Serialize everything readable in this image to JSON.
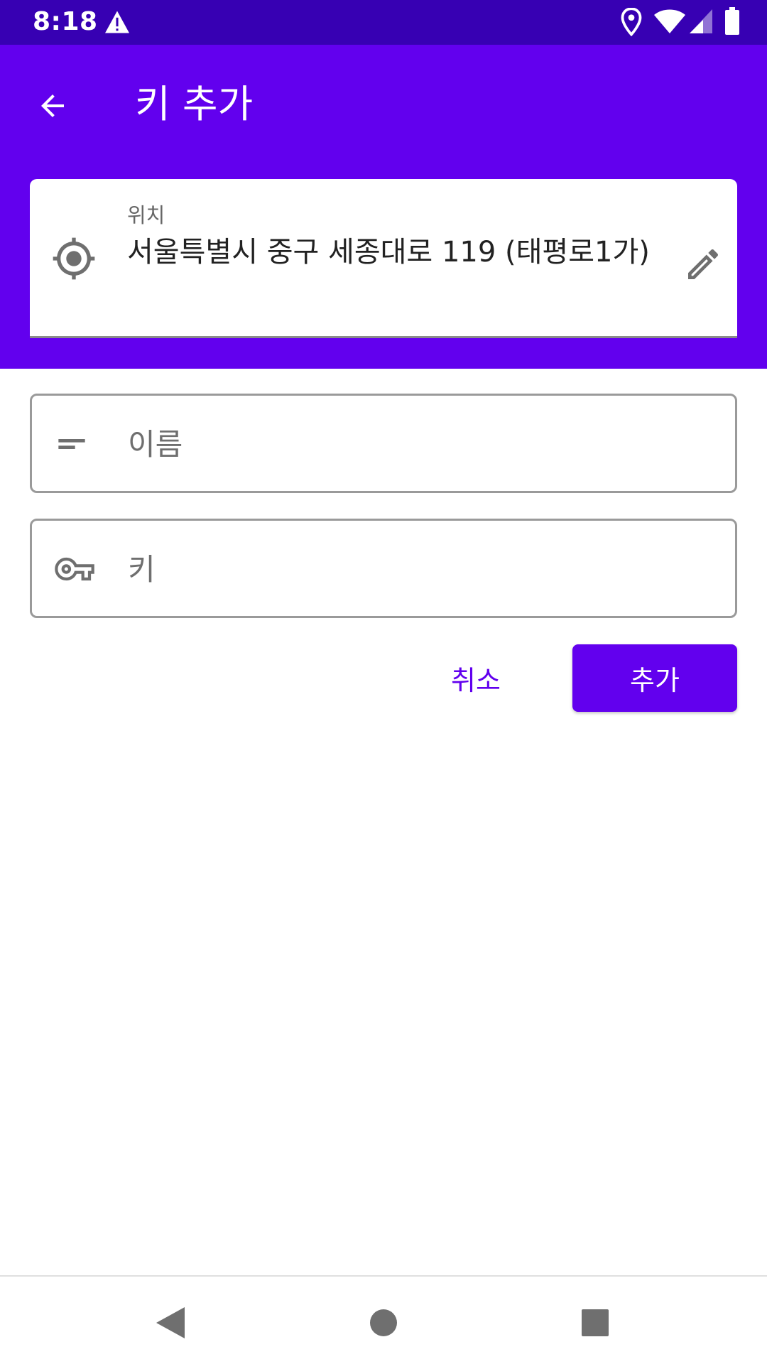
{
  "status_bar": {
    "time": "8:18",
    "icons": [
      "alert-icon",
      "location-pin-icon",
      "wifi-icon",
      "signal-icon",
      "battery-icon"
    ]
  },
  "app_bar": {
    "title": "키 추가",
    "back_icon": "arrow-back-icon"
  },
  "location": {
    "label": "위치",
    "value": "서울특별시 중구 세종대로 119 (태평로1가)",
    "icon": "gps-target-icon",
    "edit_icon": "pencil-icon"
  },
  "name_field": {
    "placeholder": "이름",
    "value": "",
    "icon": "short-text-icon"
  },
  "key_field": {
    "placeholder": "키",
    "value": "",
    "icon": "key-icon"
  },
  "actions": {
    "cancel_label": "취소",
    "add_label": "추가"
  },
  "nav_bar": {
    "buttons": [
      "back-triangle-icon",
      "home-circle-icon",
      "recents-square-icon"
    ]
  },
  "colors": {
    "status_bar": "#3700b3",
    "primary": "#6200ee",
    "on_primary": "#ffffff",
    "outline": "#9a9a9a",
    "icon_gray": "#6f6f6f"
  }
}
